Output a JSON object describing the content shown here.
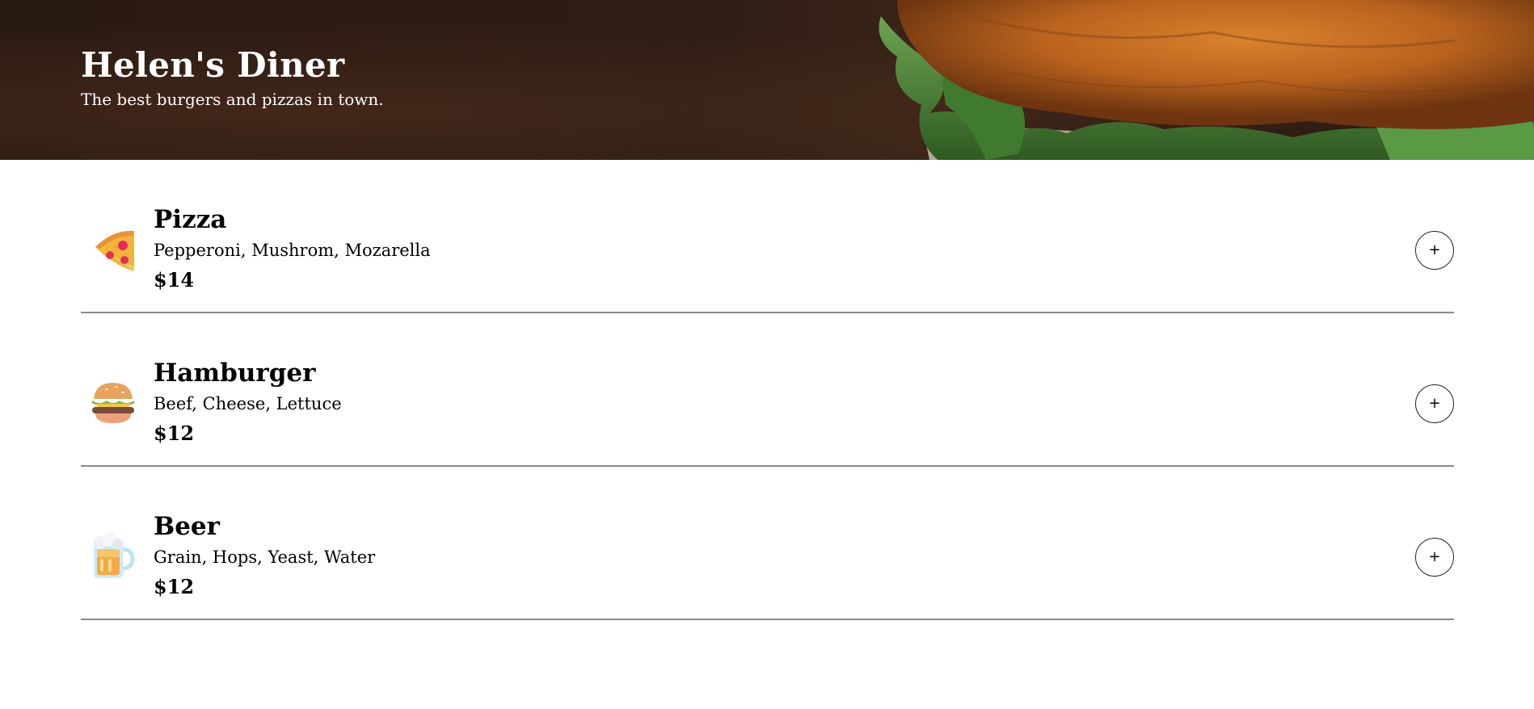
{
  "header": {
    "title": "Helen's Diner",
    "subtitle": "The best burgers and pizzas in town."
  },
  "menu": {
    "items": [
      {
        "icon": "pizza-icon",
        "name": "Pizza",
        "ingredients": "Pepperoni, Mushrom, Mozarella",
        "price": "$14",
        "add_label": "+"
      },
      {
        "icon": "hamburger-icon",
        "name": "Hamburger",
        "ingredients": "Beef, Cheese, Lettuce",
        "price": "$12",
        "add_label": "+"
      },
      {
        "icon": "beer-icon",
        "name": "Beer",
        "ingredients": "Grain, Hops, Yeast, Water",
        "price": "$12",
        "add_label": "+"
      }
    ]
  },
  "colors": {
    "hero_dark": "#2a1a14",
    "bun": "#b8621e",
    "lettuce": "#4f8a3c",
    "divider": "#8a8a8a"
  }
}
